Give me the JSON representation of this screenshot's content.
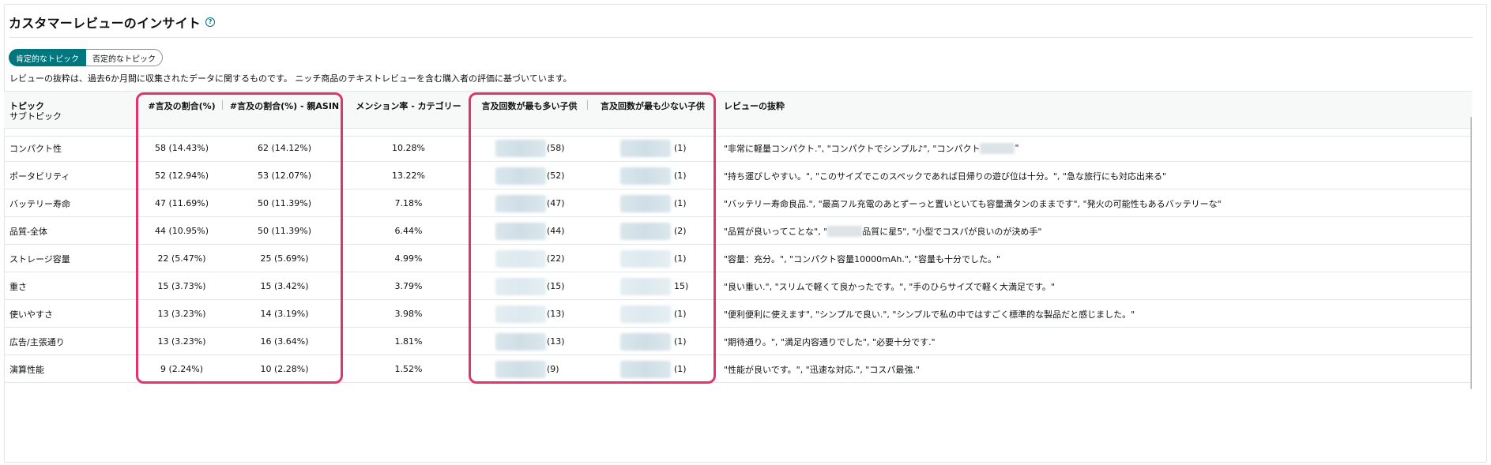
{
  "header": {
    "title": "カスタマーレビューのインサイト",
    "help_icon": "?"
  },
  "toggle": {
    "positive": "肯定的なトピック",
    "negative": "否定的なトピック",
    "selected": "positive"
  },
  "note": "レビューの抜粋は、過去6か月間に収集されたデータに関するものです。 ニッチ商品のテキストレビューを含む購入者の評価に基づいています。",
  "columns": {
    "topic": "トピック",
    "subtopic": "サブトピック",
    "mention_share": "#言及の割合(%)",
    "mention_share_parent": "#言及の割合(%) - 親ASIN",
    "mention_rate_category": "メンション率 - カテゴリー",
    "most_mentioned_child": "言及回数が最も多い子供",
    "least_mentioned_child": "言及回数が最も少ない子供",
    "excerpt": "レビューの抜粋"
  },
  "rows": [
    {
      "topic": "コンパクト性",
      "share": "58 (14.43%)",
      "parent_share": "62 (14.12%)",
      "rate": "10.28%",
      "most": "(58)",
      "least": "(1)",
      "excerpt_a": "\"非常に軽量コンパクト.\", \"コンパクトでシンプル♪\", \"コンパクト",
      "excerpt_b": "\""
    },
    {
      "topic": "ポータビリティ",
      "share": "52 (12.94%)",
      "parent_share": "53 (12.07%)",
      "rate": "13.22%",
      "most": "(52)",
      "least": "(1)",
      "excerpt_a": "\"持ち運びしやすい。\", \"このサイズでこのスペックであれば日帰りの遊び位は十分。\", \"急な旅行にも対応出来る\"",
      "excerpt_b": ""
    },
    {
      "topic": "バッテリー寿命",
      "share": "47 (11.69%)",
      "parent_share": "50 (11.39%)",
      "rate": "7.18%",
      "most": "(47)",
      "least": "(1)",
      "excerpt_a": "\"バッテリー寿命良品.\", \"最高フル充電のあとずーっと置いといても容量満タンのままです\", \"発火の可能性もあるバッテリーな\"",
      "excerpt_b": ""
    },
    {
      "topic": "品質-全体",
      "share": "44 (10.95%)",
      "parent_share": "50 (11.39%)",
      "rate": "6.44%",
      "most": "(44)",
      "least": "(2)",
      "excerpt_a": "\"品質が良いってことな\", \"",
      "excerpt_b": "品質に星5\", \"小型でコスパが良いのが決め手\""
    },
    {
      "topic": "ストレージ容量",
      "share": "22 (5.47%)",
      "parent_share": "25 (5.69%)",
      "rate": "4.99%",
      "most": "(22)",
      "least": "(1)",
      "excerpt_a": "\"容量：充分。\", \"コンパクト容量10000mAh.\", \"容量も十分でした。\"",
      "excerpt_b": ""
    },
    {
      "topic": "重さ",
      "share": "15 (3.73%)",
      "parent_share": "15 (3.42%)",
      "rate": "3.79%",
      "most": "(15)",
      "least": "15)",
      "excerpt_a": "\"良い重い.\", \"スリムで軽くて良かったです。\", \"手のひらサイズで軽く大満足です。\"",
      "excerpt_b": ""
    },
    {
      "topic": "使いやすさ",
      "share": "13 (3.23%)",
      "parent_share": "14 (3.19%)",
      "rate": "3.98%",
      "most": "(13)",
      "least": "(1)",
      "excerpt_a": "\"便利便利に使えます\", \"シンプルで良い.\", \"シンプルで私の中ではすごく標準的な製品だと感じました。\"",
      "excerpt_b": ""
    },
    {
      "topic": "広告/主張通り",
      "share": "13 (3.23%)",
      "parent_share": "16 (3.64%)",
      "rate": "1.81%",
      "most": "(13)",
      "least": "(1)",
      "excerpt_a": "\"期待通り。\", \"満足内容通りでした\", \"必要十分です.\"",
      "excerpt_b": ""
    },
    {
      "topic": "演算性能",
      "share": "9 (2.24%)",
      "parent_share": "10 (2.28%)",
      "rate": "1.52%",
      "most": "(9)",
      "least": "(1)",
      "excerpt_a": "\"性能が良いです。\", \"迅速な対応.\", \"コスパ最強.\"",
      "excerpt_b": ""
    }
  ],
  "highlight_color": "#e4336b",
  "accent_color": "#00767e"
}
